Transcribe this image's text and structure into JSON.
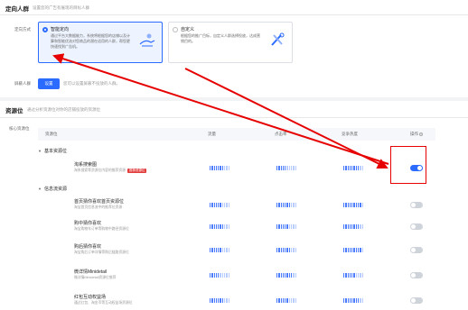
{
  "section1": {
    "title": "定向人群",
    "desc": "设置您的广告有展现的目标人群",
    "mode_label": "定向方式",
    "cards": [
      {
        "title": "智能定向",
        "desc": "通过平台大数据能力，系统将根据您的店铺以及计算和智能优选对您商品的潜在适用的人群，帮您更快速找到广告机。",
        "selected": true
      },
      {
        "title": "自定义",
        "desc": "根据您的推广目标，自定义人群选择投放，达成营销目的。",
        "selected": false
      }
    ],
    "crowd_label": "屏蔽人群",
    "crowd_button": "设置",
    "crowd_hint": "您可以设置屏蔽不投放的人群。"
  },
  "section2": {
    "title": "资源位",
    "desc": "通过分析资源位对你的店铺投放的资源位",
    "side_label": "核心资源位",
    "headers": [
      "资源位",
      "流量",
      "点击率",
      "转化率",
      "竞争热度",
      "操作"
    ],
    "groups": [
      {
        "name": "基本资源位"
      },
      {
        "name": "信息流资源"
      }
    ],
    "rows": [
      {
        "name": "淘系搜索图",
        "sub": "淘系搜索等资源位内容的推荐资源",
        "tag": "推荐资源位",
        "enabled": true
      },
      {
        "name": "首页猜你喜欢首页资源位",
        "sub": "淘宝首页信息流中的推荐位资源",
        "enabled": false
      },
      {
        "name": "购中猜你喜欢",
        "sub": "淘宝购物车订单等购物中路径资源位",
        "enabled": false
      },
      {
        "name": "购后猜你喜欢",
        "sub": "淘宝购后订单详情等购后链路资源位",
        "enabled": false
      },
      {
        "name": "微详情Minidetail",
        "sub": "微详情Minidetail资源位推荐",
        "enabled": false
      },
      {
        "name": "红包互动权益场",
        "sub": "通过红包、淘金币等互动权益场资源位",
        "enabled": false
      }
    ]
  },
  "colors": {
    "accent": "#2b6bff",
    "annotation": "#e60000"
  }
}
